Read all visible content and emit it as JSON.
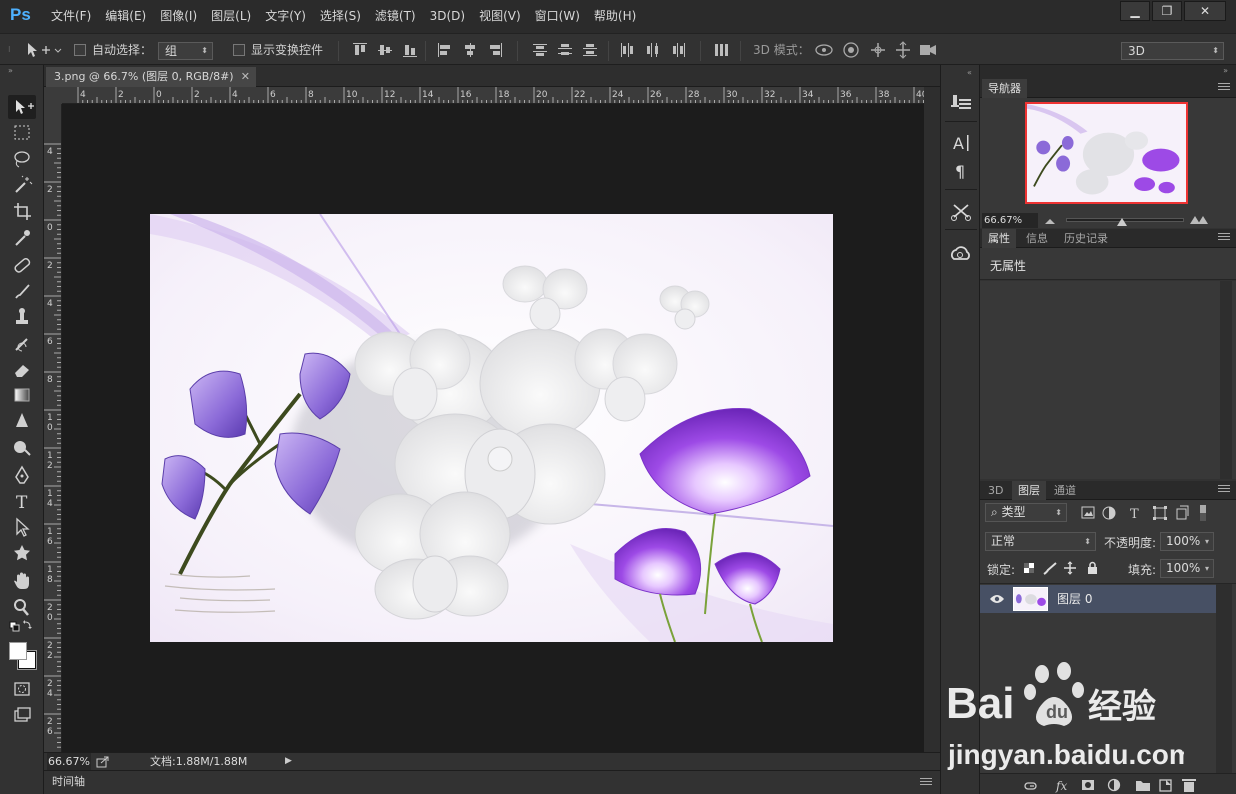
{
  "app": {
    "logo": "Ps"
  },
  "menu": [
    "文件(F)",
    "编辑(E)",
    "图像(I)",
    "图层(L)",
    "文字(Y)",
    "选择(S)",
    "滤镜(T)",
    "3D(D)",
    "视图(V)",
    "窗口(W)",
    "帮助(H)"
  ],
  "window_buttons": {
    "minimize": "▁",
    "restore": "❐",
    "close": "✕"
  },
  "options": {
    "auto_select_label": "自动选择：",
    "auto_select_value": "组",
    "show_transform_label": "显示变换控件",
    "mode_3d_label": "3D 模式：",
    "workspace_value": "3D"
  },
  "document": {
    "tab_title": "3.png @ 66.7% (图层 0, RGB/8#)",
    "tab_close": "✕",
    "ruler_top": [
      "4",
      "2",
      "0",
      "2",
      "4",
      "6",
      "8",
      "10",
      "12",
      "14",
      "16",
      "18",
      "20",
      "22",
      "24",
      "26",
      "28",
      "30",
      "32",
      "34",
      "36",
      "38",
      "40"
    ],
    "ruler_left": [
      "4",
      "2",
      "0",
      "2",
      "4",
      "6",
      "8",
      "10",
      "12",
      "14",
      "16",
      "18",
      "20",
      "22",
      "24",
      "26"
    ],
    "zoom": "66.67%",
    "doc_info": "文档:1.88M/1.88M",
    "status_arrow": "▶"
  },
  "timeline": {
    "label": "时间轴"
  },
  "navigator": {
    "tab": "导航器",
    "zoom": "66.67%"
  },
  "properties": {
    "tabs": [
      "属性",
      "信息",
      "历史记录"
    ],
    "empty_text": "无属性"
  },
  "layers": {
    "tabs": [
      "3D",
      "图层",
      "通道"
    ],
    "filter_value": "类型",
    "blend_mode": "正常",
    "opacity_label": "不透明度:",
    "opacity_value": "100%",
    "lock_label": "锁定:",
    "fill_label": "填充:",
    "fill_value": "100%",
    "layer_name": "图层 0"
  },
  "watermark": {
    "brand": "Bai du 经验",
    "url": "jingyan.baidu.com"
  }
}
